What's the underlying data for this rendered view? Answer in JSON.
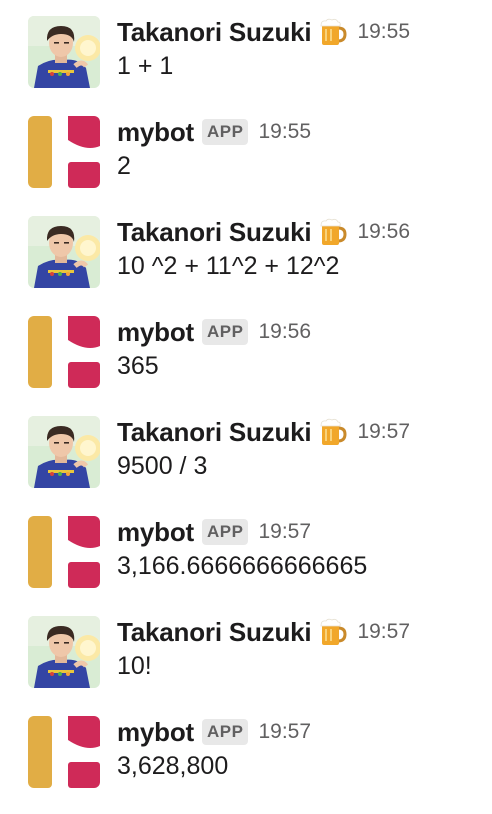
{
  "messages": [
    {
      "sender": "Takanori Suzuki",
      "is_bot": false,
      "status_icon": "beer-mug-icon",
      "time": "19:55",
      "text": "1 + 1"
    },
    {
      "sender": "mybot",
      "is_bot": true,
      "badge": "APP",
      "time": "19:55",
      "text": "2"
    },
    {
      "sender": "Takanori Suzuki",
      "is_bot": false,
      "status_icon": "beer-mug-icon",
      "time": "19:56",
      "text": "10 ^2 + 11^2 + 12^2"
    },
    {
      "sender": "mybot",
      "is_bot": true,
      "badge": "APP",
      "time": "19:56",
      "text": "365"
    },
    {
      "sender": "Takanori Suzuki",
      "is_bot": false,
      "status_icon": "beer-mug-icon",
      "time": "19:57",
      "text": "9500 / 3"
    },
    {
      "sender": "mybot",
      "is_bot": true,
      "badge": "APP",
      "time": "19:57",
      "text": "3,166.6666666666665"
    },
    {
      "sender": "Takanori Suzuki",
      "is_bot": false,
      "status_icon": "beer-mug-icon",
      "time": "19:57",
      "text": "10!"
    },
    {
      "sender": "mybot",
      "is_bot": true,
      "badge": "APP",
      "time": "19:57",
      "text": "3,628,800"
    }
  ],
  "colors": {
    "bot_logo_yellow": "#e1ad45",
    "bot_logo_red": "#cf2a58",
    "avatar_shirt_blue": "#3445a4",
    "avatar_background": "#d9ecd4",
    "timestamp": "#616061",
    "badge_bg": "#e8e8e8"
  }
}
